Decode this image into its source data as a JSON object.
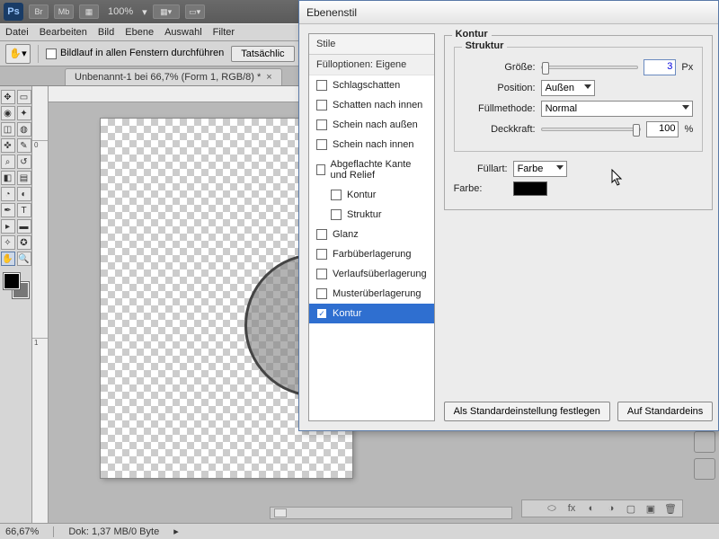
{
  "topbar": {
    "ps": "Ps",
    "chips": [
      "Br",
      "Mb",
      "▦"
    ],
    "zoom": "100%"
  },
  "menubar": [
    "Datei",
    "Bearbeiten",
    "Bild",
    "Ebene",
    "Auswahl",
    "Filter"
  ],
  "optbar": {
    "scrollall": "Bildlauf in allen Fenstern durchführen",
    "actual": "Tatsächlic"
  },
  "doctab": {
    "title": "Unbenannt-1 bei 66,7% (Form 1, RGB/8) *",
    "close": "×"
  },
  "rulerv": [
    "0",
    "1"
  ],
  "status": {
    "zoom": "66,67%",
    "doc": "Dok: 1,37 MB/0 Byte"
  },
  "dialog": {
    "title": "Ebenenstil",
    "stile_hdr": "Stile",
    "fillopt": "Fülloptionen: Eigene",
    "items": {
      "schlagschatten": "Schlagschatten",
      "schatten_innen": "Schatten nach innen",
      "schein_aussen": "Schein nach außen",
      "schein_innen": "Schein nach innen",
      "kante_relief": "Abgeflachte Kante und Relief",
      "kontur_sub": "Kontur",
      "struktur_sub": "Struktur",
      "glanz": "Glanz",
      "farbueber": "Farbüberlagerung",
      "verlauf": "Verlaufsüberlagerung",
      "muster": "Musterüberlagerung",
      "kontur": "Kontur"
    },
    "fs_kontur": "Kontur",
    "fs_struktur": "Struktur",
    "groesse_lbl": "Größe:",
    "groesse_val": "3",
    "px": "Px",
    "position_lbl": "Position:",
    "position_val": "Außen",
    "fuellmeth_lbl": "Füllmethode:",
    "fuellmeth_val": "Normal",
    "deckkraft_lbl": "Deckkraft:",
    "deckkraft_val": "100",
    "pct": "%",
    "fuellart_lbl": "Füllart:",
    "fuellart_val": "Farbe",
    "farbe_lbl": "Farbe:",
    "btn_default": "Als Standardeinstellung festlegen",
    "btn_reset": "Auf Standardeins"
  }
}
